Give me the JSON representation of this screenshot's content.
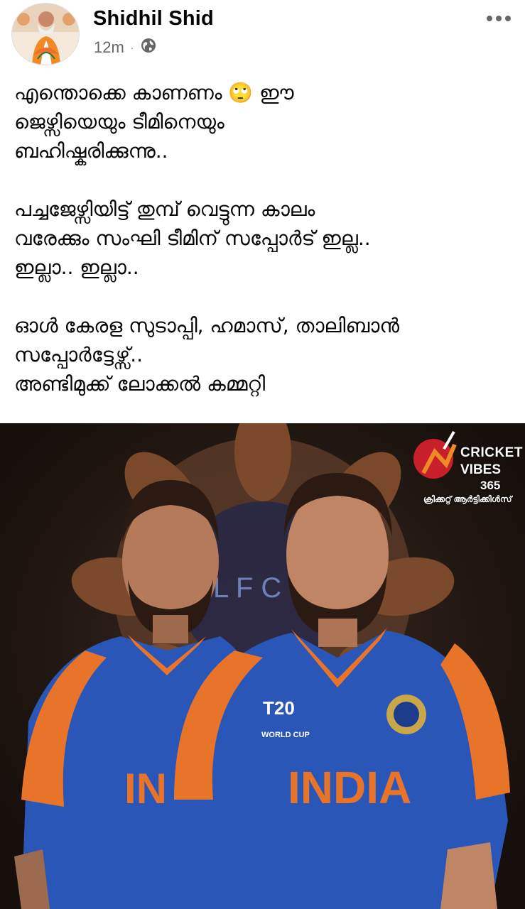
{
  "post": {
    "author": "Shidhil Shid",
    "time": "12m",
    "separator": "·",
    "privacy_icon": "globe-icon",
    "more_icon": "more-horizontal-icon",
    "paragraphs": [
      "എന്തൊക്കെ കാണണം 🙄 ഈ\nജെഴ്സിയെയും ടീമിനെയും\nബഹിഷ്കരിക്കുന്നു..",
      "പച്ചജേഴ്സിയിട്ട് തുമ്പ് വെട്ടുന്ന കാലം\nവരേക്കും സംഘി ടീമിന് സപ്പോർട് ഇല്ല..\nഇല്ലാ.. ഇല്ലാ..",
      "ഓൾ കേരള സുടാപ്പി, ഹമാസ്, താലിബാൻ\nസപ്പോർട്ടേഴ്സ്..\nഅണ്ടിമുക്ക് ലോക്കൽ കമ്മറ്റി"
    ]
  },
  "image": {
    "brand_line1": "CRICKET",
    "brand_line2": "VIBES",
    "brand_line3": "365",
    "brand_line4": "ക്രിക്കറ്റ് ആർട്ടിക്കിൾസ്",
    "left_jersey_text": "IN",
    "right_jersey_text": "INDIA",
    "world_cup_text": "WORLD CUP",
    "t20_text": "T20",
    "crest_text": "L F C"
  },
  "colors": {
    "jersey_blue": "#2a56b8",
    "jersey_orange": "#e8742a",
    "background": "#1f1712",
    "meta_gray": "#65676b"
  }
}
